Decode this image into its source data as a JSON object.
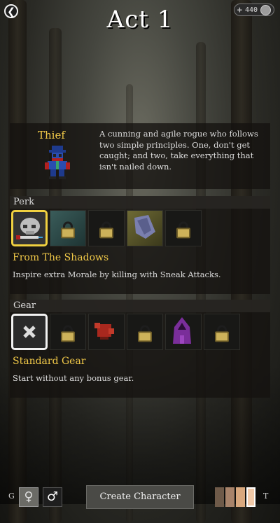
{
  "header": {
    "title": "Act 1",
    "back_icon": "back-arrow-icon",
    "currency": {
      "plus": "+",
      "amount": "440",
      "icon": "coin-icon"
    }
  },
  "character": {
    "name": "Thief",
    "description": "A cunning and agile rogue who follows two simple principles. One, don't get caught; and two, take everything that isn't nailed down."
  },
  "perk": {
    "header": "Perk",
    "selected_name": "From The Shadows",
    "selected_description": "Inspire extra Morale by killing with Sneak Attacks.",
    "slots": [
      {
        "icon": "skull-dagger-icon",
        "locked": false,
        "selected": true
      },
      {
        "icon": "lock-icon",
        "locked": true
      },
      {
        "icon": "lock-icon",
        "locked": true
      },
      {
        "icon": "cloak-icon",
        "locked": false
      },
      {
        "icon": "lock-icon",
        "locked": true
      }
    ]
  },
  "gear": {
    "header": "Gear",
    "selected_name": "Standard Gear",
    "selected_description": "Start without any bonus gear.",
    "slots": [
      {
        "icon": "none-x-icon",
        "locked": false,
        "selected": true
      },
      {
        "icon": "lock-icon",
        "locked": true
      },
      {
        "icon": "red-creature-icon",
        "locked": false
      },
      {
        "icon": "lock-icon",
        "locked": true
      },
      {
        "icon": "purple-hood-icon",
        "locked": false
      },
      {
        "icon": "lock-icon",
        "locked": true
      }
    ]
  },
  "bottom": {
    "gender_label": "G",
    "female_symbol": "♀",
    "male_symbol": "♂",
    "create_button": "Create Character",
    "tone_label": "T",
    "skin_tones": [
      "#6e5a49",
      "#a8836a",
      "#d9a87e",
      "#f1c9a8"
    ],
    "selected_tone_index": 3
  },
  "colors": {
    "accent_gold": "#f0c848",
    "perk_highlight": "#f0d040"
  }
}
